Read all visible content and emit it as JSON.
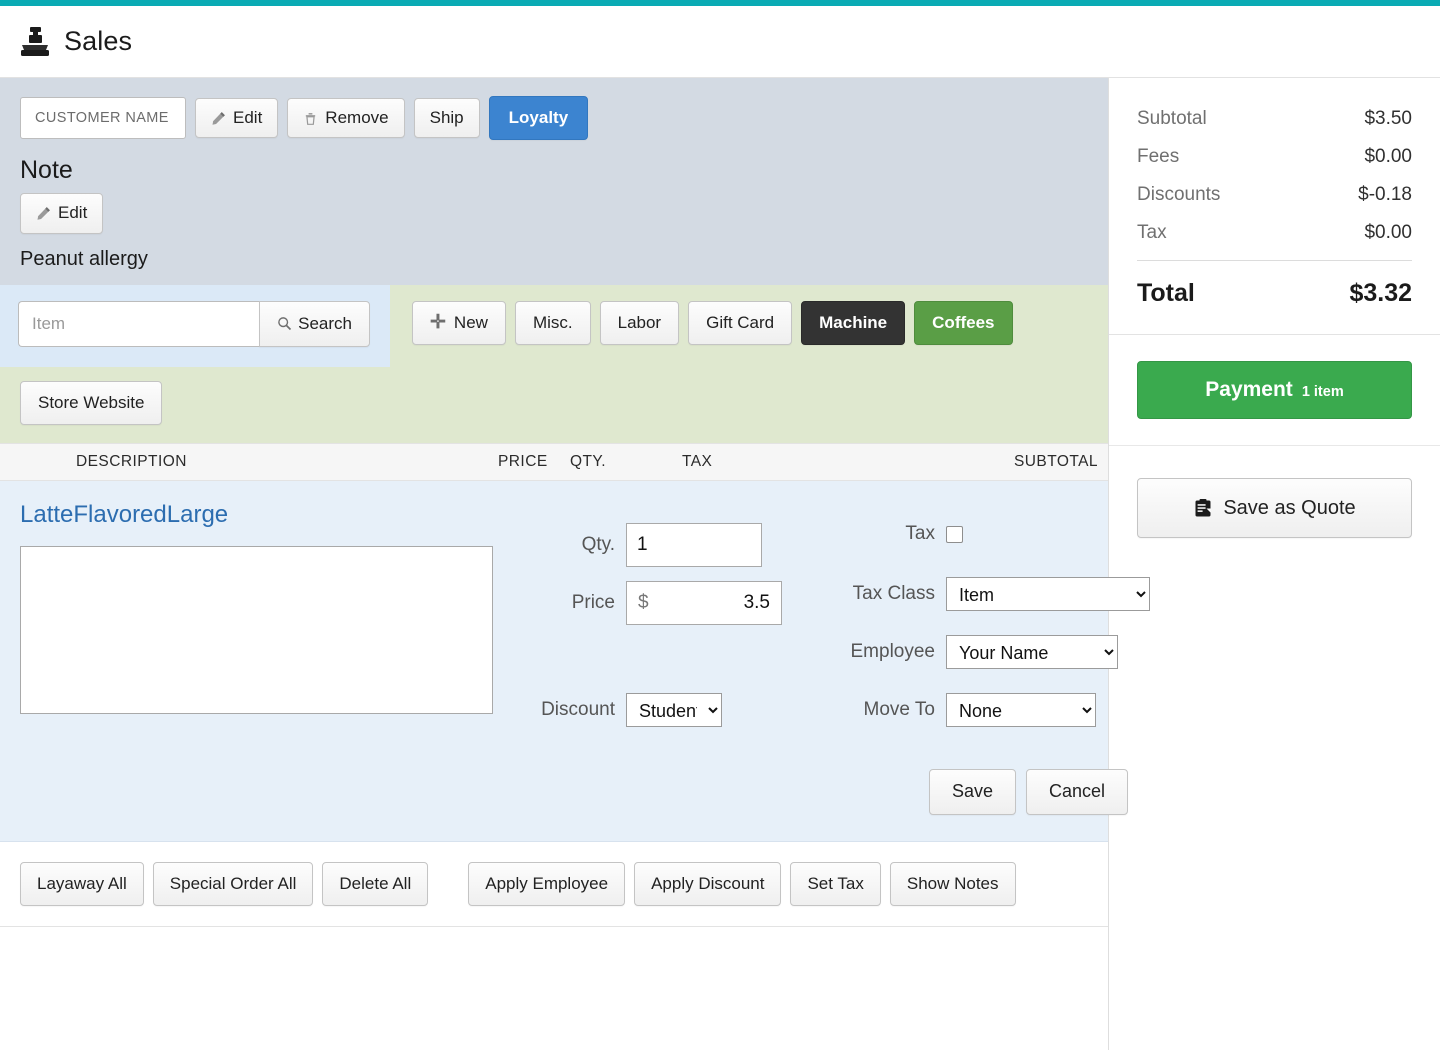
{
  "theme": {
    "accent": "#0aabb4",
    "primary_blue": "#3c84d0",
    "payment_green": "#3aaa4e",
    "category_green": "#5a9e46",
    "category_dark": "#333333",
    "customer_band_bg": "#d3dae3",
    "search_band_bg": "#dfe8cf",
    "search_panel_bg": "#dbe9f7",
    "item_row_bg": "#e7f0f9",
    "item_name_color": "#2c6db0"
  },
  "header": {
    "title": "Sales",
    "icon": "cash-register-icon"
  },
  "customer": {
    "name_placeholder": "CUSTOMER NAME",
    "name_value": "",
    "edit_label": "Edit",
    "remove_label": "Remove",
    "ship_label": "Ship",
    "loyalty_label": "Loyalty",
    "edit_icon": "pencil-icon",
    "remove_icon": "trash-icon"
  },
  "note": {
    "heading": "Note",
    "edit_label": "Edit",
    "edit_icon": "pencil-icon",
    "text": "Peanut allergy"
  },
  "search": {
    "placeholder": "Item",
    "value": "",
    "button_label": "Search",
    "button_icon": "search-icon"
  },
  "categories": [
    {
      "label": "New",
      "style": "default",
      "icon": "plus-icon"
    },
    {
      "label": "Misc.",
      "style": "default"
    },
    {
      "label": "Labor",
      "style": "default"
    },
    {
      "label": "Gift Card",
      "style": "default"
    },
    {
      "label": "Machine",
      "style": "dark"
    },
    {
      "label": "Coffees",
      "style": "green"
    }
  ],
  "store_website_label": "Store Website",
  "table": {
    "columns": {
      "description": "DESCRIPTION",
      "price": "PRICE",
      "qty": "QTY.",
      "tax": "TAX",
      "subtotal": "SUBTOTAL"
    }
  },
  "item": {
    "name": "LatteFlavoredLarge",
    "note_value": "",
    "qty_label": "Qty.",
    "qty_value": "1",
    "price_label": "Price",
    "price_currency": "$",
    "price_value": "3.5",
    "discount_label": "Discount",
    "discount_value": "Student",
    "discount_options": [
      "Student"
    ],
    "tax_label": "Tax",
    "tax_checked": false,
    "tax_class_label": "Tax Class",
    "tax_class_value": "Item",
    "tax_class_options": [
      "Item"
    ],
    "employee_label": "Employee",
    "employee_value": "Your Name",
    "employee_options": [
      "Your Name"
    ],
    "move_to_label": "Move To",
    "move_to_value": "None",
    "move_to_options": [
      "None"
    ],
    "save_label": "Save",
    "cancel_label": "Cancel"
  },
  "actions": {
    "left": [
      "Layaway All",
      "Special Order All",
      "Delete All"
    ],
    "right": [
      "Apply Employee",
      "Apply Discount",
      "Set Tax",
      "Show Notes"
    ]
  },
  "totals": {
    "rows": [
      {
        "label": "Subtotal",
        "value": "$3.50"
      },
      {
        "label": "Fees",
        "value": "$0.00"
      },
      {
        "label": "Discounts",
        "value": "$-0.18"
      },
      {
        "label": "Tax",
        "value": "$0.00"
      }
    ],
    "total_label": "Total",
    "total_value": "$3.32"
  },
  "payment": {
    "label": "Payment",
    "count": "1 item"
  },
  "quote": {
    "label": "Save as Quote",
    "icon": "clipboard-icon"
  }
}
